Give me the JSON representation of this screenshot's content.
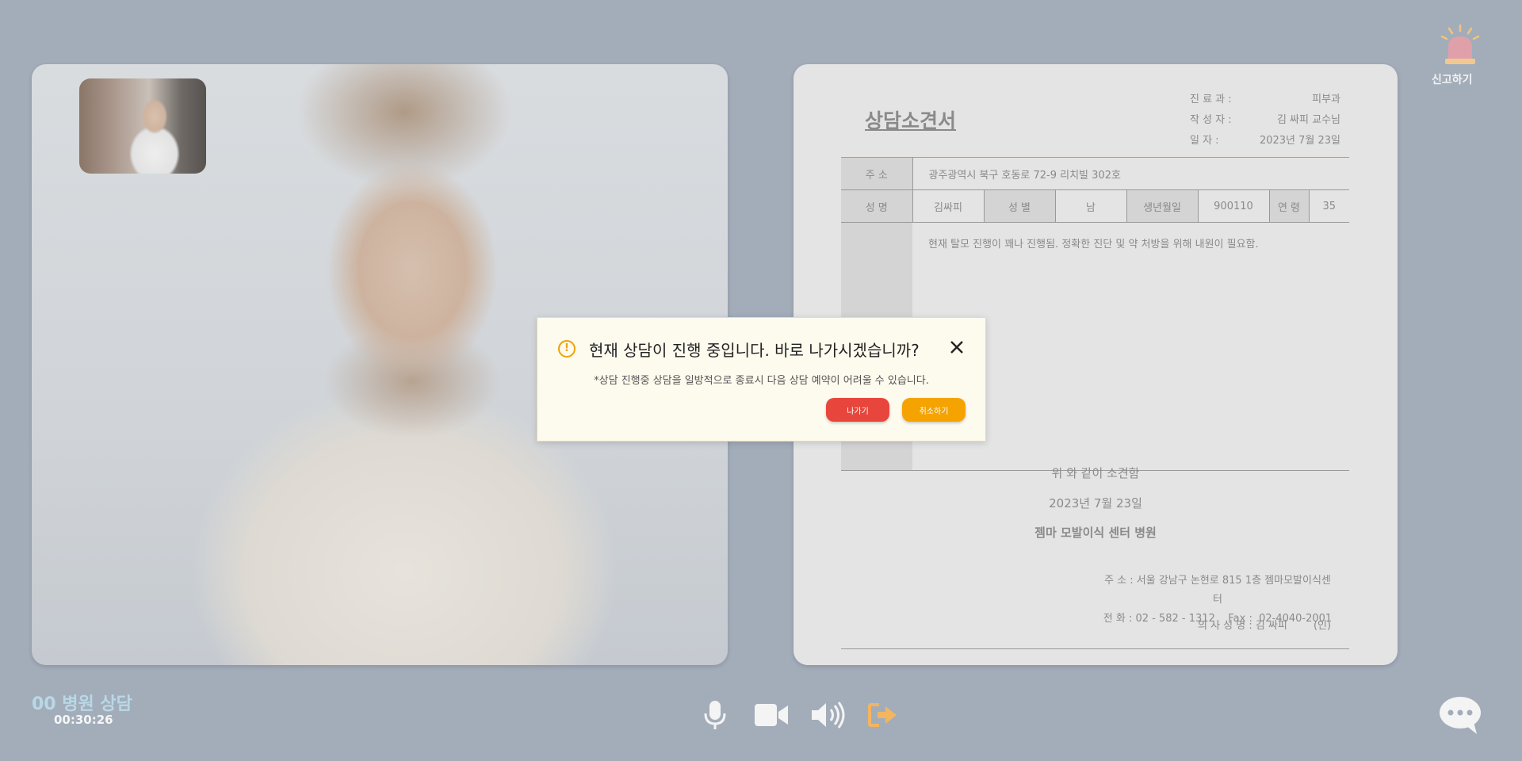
{
  "report": {
    "label": "신고하기"
  },
  "session": {
    "room": "00 병원 상담",
    "timer": "00:30:26"
  },
  "document": {
    "title": "상담소견서",
    "meta": [
      {
        "label": "진 료 과 :",
        "value": "피부과"
      },
      {
        "label": "작 성 자 :",
        "value": "김 싸피 교수님"
      },
      {
        "label": "일      자 :",
        "value": "2023년 7월 23일"
      }
    ],
    "address_label": "주 소",
    "address_value": "광주광역시 북구 호동로 72-9 리치빌 302호",
    "name_label": "성 명",
    "name_value": "김싸피",
    "gender_label": "성 별",
    "gender_value": "남",
    "birth_label": "생년월일",
    "birth_value": "900110",
    "age_label": "연 령",
    "age_value": "35",
    "consult_label": "상 담",
    "consult_text": "현재 탈모 진행이 꽤나 진행됨. 정확한 진단 및 약 처방을 위해 내원이 필요함.",
    "conclusion": "위 와 같이 소견함",
    "date": "2023년 7월 23일",
    "hospital": "젬마 모발이식 센터 병원",
    "hospital_address": "주 소 : 서울 강남구 논현로 815 1층 젬마모발이식센터",
    "hospital_phone": "전 화 : 02 - 582 - 1312    Fax :  02-4040-2001",
    "doctor_sign": "의 사 성 명 : 김 싸피        (인)"
  },
  "modal": {
    "title": "현재 상담이 진행 중입니다. 바로 나가시겠습니까?",
    "subtitle": "*상담 진행중 상담을 일방적으로 종료시 다음 상담 예약이 어려울 수 있습니다.",
    "exit_label": "나가기",
    "cancel_label": "취소하기"
  },
  "icons": {
    "mic": "microphone-icon",
    "camera": "video-camera-icon",
    "speaker": "speaker-icon",
    "leave": "leave-icon",
    "chat": "chat-bubble-icon",
    "alarm": "siren-icon",
    "warning": "warning-icon",
    "close": "close-icon"
  },
  "colors": {
    "background": "#a3adba",
    "exit_button": "#e8463c",
    "cancel_button": "#f5a300",
    "leave_icon": "#f2b560",
    "room_title": "#b9d8e6"
  }
}
